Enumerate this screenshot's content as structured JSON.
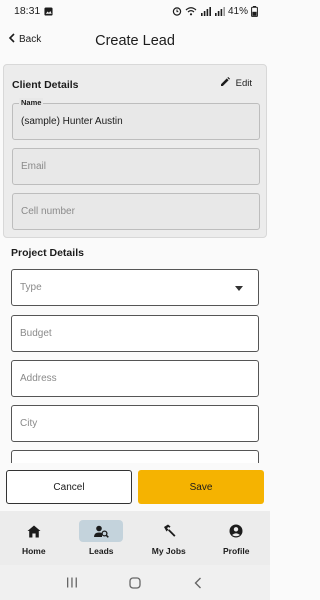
{
  "status_bar": {
    "time": "18:31",
    "battery": "41%",
    "icons": [
      "gallery-icon",
      "alarm-icon",
      "wifi-icon",
      "signal-icon",
      "signal-icon",
      "battery-icon"
    ]
  },
  "app_bar": {
    "back_label": "Back",
    "title": "Create Lead"
  },
  "client_details": {
    "title": "Client Details",
    "edit_label": "Edit",
    "name_label": "Name",
    "name_value": "(sample) Hunter Austin",
    "email_placeholder": "Email",
    "cell_placeholder": "Cell number"
  },
  "project_details": {
    "title": "Project Details",
    "type_placeholder": "Type",
    "budget_placeholder": "Budget",
    "address_placeholder": "Address",
    "city_placeholder": "City"
  },
  "actions": {
    "cancel_label": "Cancel",
    "save_label": "Save",
    "save_color": "#f5b301"
  },
  "bottom_nav": {
    "items": [
      {
        "label": "Home",
        "icon": "home-icon",
        "active": false
      },
      {
        "label": "Leads",
        "icon": "leads-search-icon",
        "active": true
      },
      {
        "label": "My Jobs",
        "icon": "hammer-icon",
        "active": false
      },
      {
        "label": "Profile",
        "icon": "profile-icon",
        "active": false
      }
    ]
  }
}
